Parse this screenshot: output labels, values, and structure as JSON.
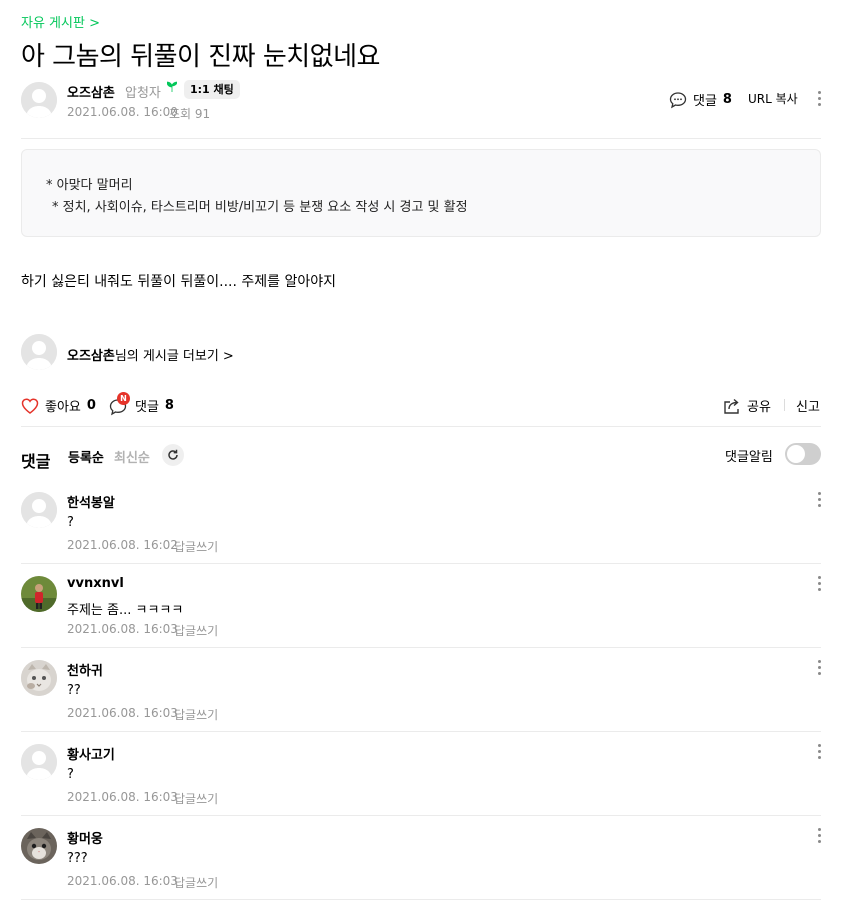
{
  "board": {
    "name": "자유 게시판 >"
  },
  "post": {
    "title": "아 그놈의 뒤풀이 진짜 눈치없네요",
    "author": "오즈삼촌",
    "grade": "압청자",
    "chat_button": "1:1 채팅",
    "date": "2021.06.08. 16:00",
    "views": "조회 91",
    "comment_link_label": "댓글",
    "comment_count": "8",
    "url_copy": "URL 복사",
    "notice_line1": "* 아맞다 말머리",
    "notice_line2": "* 정치, 사회이슈, 타스트리머 비방/비꼬기 등 분쟁 요소 작성 시 경고 및 활정",
    "content": "하기 싫은티 내줘도 뒤풀이 뒤풀이.... 주제를 알아야지",
    "more_author": "오즈삼촌",
    "more_suffix": "님의 게시글 더보기 >"
  },
  "actions": {
    "like_label": "좋아요",
    "like_count": "0",
    "comment_label": "댓글",
    "comment_count": "8",
    "new_badge": "N",
    "share": "공유",
    "report": "신고"
  },
  "comments_section": {
    "title": "댓글",
    "sort_registered": "등록순",
    "sort_latest": "최신순",
    "notify_label": "댓글알림"
  },
  "comments": [
    {
      "nick": "한석봉알",
      "text": "?",
      "date": "2021.06.08. 16:02",
      "reply": "답글쓰기",
      "avatar": "default"
    },
    {
      "nick": "vvnxnvl",
      "text": "주제는 좀... ㅋㅋㅋㅋ",
      "date": "2021.06.08. 16:03",
      "reply": "답글쓰기",
      "avatar": "photo-green"
    },
    {
      "nick": "천하귀",
      "text": "??",
      "date": "2021.06.08. 16:03",
      "reply": "답글쓰기",
      "avatar": "photo-cat"
    },
    {
      "nick": "황사고기",
      "text": "?",
      "date": "2021.06.08. 16:03",
      "reply": "답글쓰기",
      "avatar": "default"
    },
    {
      "nick": "황머웅",
      "text": "???",
      "date": "2021.06.08. 16:03",
      "reply": "답글쓰기",
      "avatar": "photo-cat-dark"
    }
  ],
  "colors": {
    "accent": "#03c75a",
    "badge": "#e5332a",
    "muted": "#979797",
    "divider": "#ebebeb"
  }
}
